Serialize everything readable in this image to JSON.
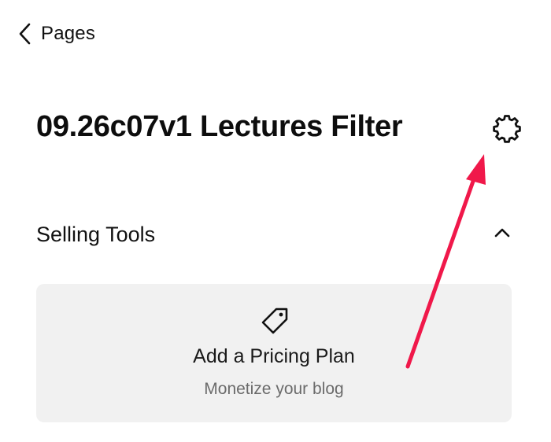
{
  "nav": {
    "back_label": "Pages"
  },
  "header": {
    "title": "09.26c07v1 Lectures Filter",
    "settings_icon": "gear-icon"
  },
  "section": {
    "title": "Selling Tools",
    "toggle_icon": "chevron-up-icon",
    "expanded": true
  },
  "card": {
    "icon": "tag-icon",
    "title": "Add a Pricing Plan",
    "subtitle": "Monetize your blog"
  },
  "annotation": {
    "arrow_color": "#f0184a"
  },
  "colors": {
    "card_background": "#f1f1f1",
    "text_primary": "#111111",
    "text_secondary": "#6b6b6b"
  }
}
